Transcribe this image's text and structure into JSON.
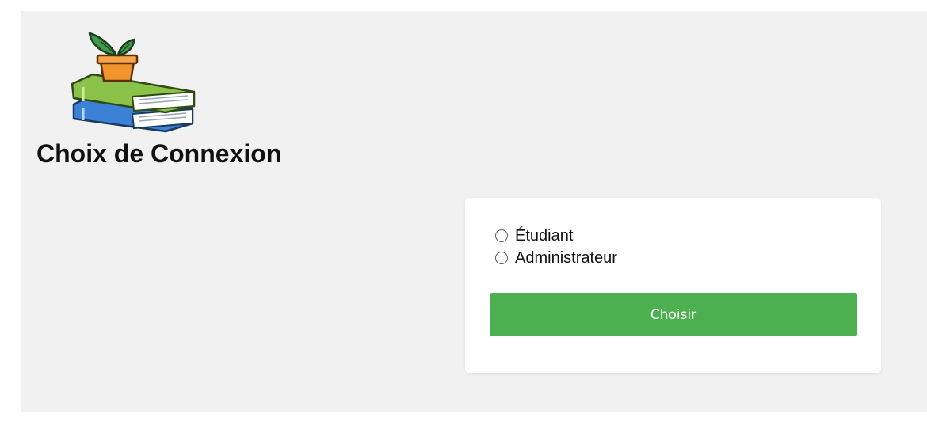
{
  "header": {
    "title": "Choix de Connexion",
    "logo_icon": "books-with-plant-icon"
  },
  "form": {
    "options": [
      {
        "label": "Étudiant",
        "selected": false
      },
      {
        "label": "Administrateur",
        "selected": false
      }
    ],
    "submit_label": "Choisir"
  },
  "colors": {
    "page_background": "#f1f1f1",
    "card_background": "#ffffff",
    "button": "#4caf50",
    "button_text": "#ffffff"
  }
}
